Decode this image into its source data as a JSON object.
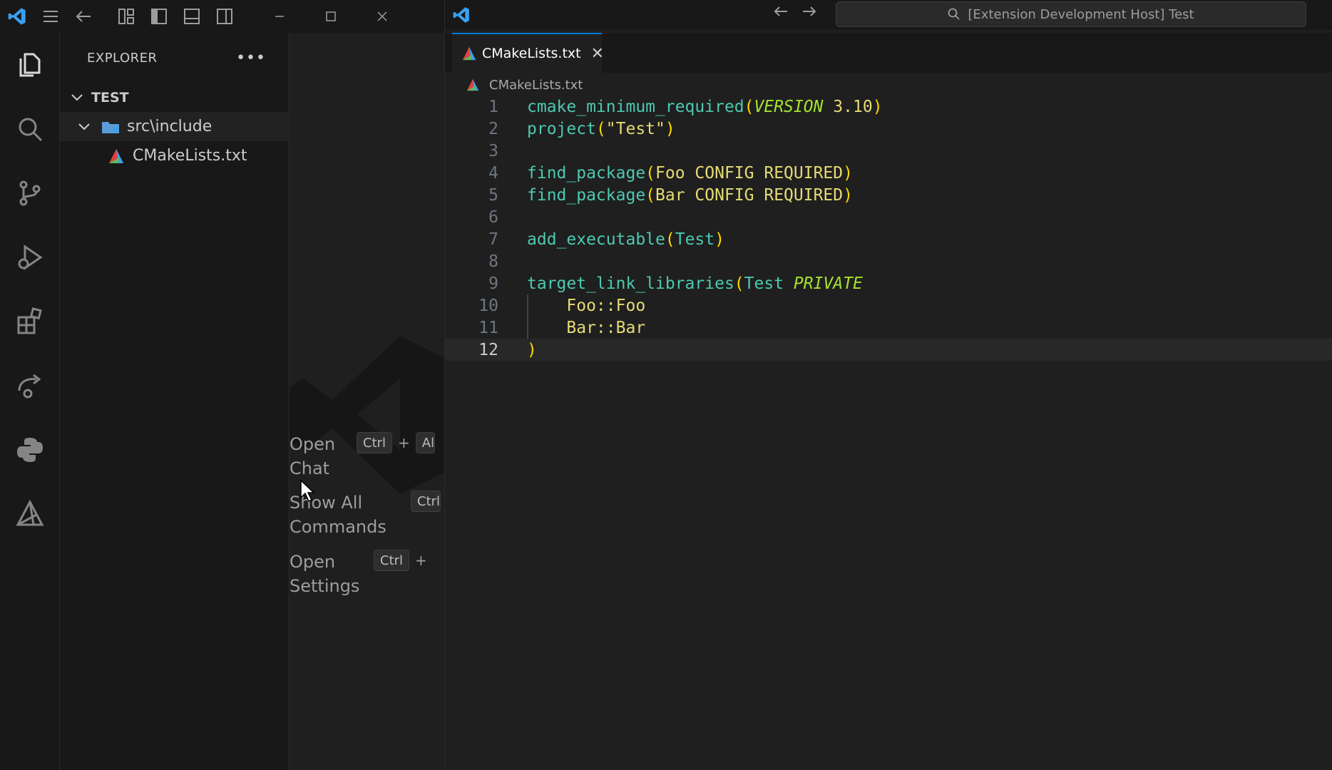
{
  "left_window": {
    "explorer": {
      "header": "EXPLORER",
      "more": "•••",
      "root_folder": "TEST",
      "items": [
        {
          "label": "src\\include",
          "type": "folder"
        },
        {
          "label": "CMakeLists.txt",
          "type": "file"
        }
      ]
    },
    "welcome": {
      "commands": [
        {
          "label_line1": "Open",
          "label_line2": "Chat",
          "keys": [
            "Ctrl",
            "Al"
          ]
        },
        {
          "label_line1": "Show All",
          "label_line2": "Commands",
          "keys": [
            "Ctrl"
          ]
        },
        {
          "label_line1": "Open",
          "label_line2": "Settings",
          "keys": [
            "Ctrl"
          ]
        }
      ],
      "plus": "+"
    }
  },
  "right_window": {
    "search_text": "[Extension Development Host] Test",
    "tab_label": "CMakeLists.txt",
    "breadcrumb": "CMakeLists.txt",
    "code_lines": [
      {
        "n": "1",
        "parts": [
          [
            "fn",
            "cmake_minimum_required"
          ],
          [
            "paren",
            "("
          ],
          [
            "ital",
            "VERSION"
          ],
          [
            "plain",
            " 3.10"
          ],
          [
            "paren",
            ")"
          ]
        ]
      },
      {
        "n": "2",
        "parts": [
          [
            "fn",
            "project"
          ],
          [
            "paren",
            "("
          ],
          [
            "str",
            "\"Test\""
          ],
          [
            "paren",
            ")"
          ]
        ]
      },
      {
        "n": "3",
        "parts": []
      },
      {
        "n": "4",
        "parts": [
          [
            "fn",
            "find_package"
          ],
          [
            "paren",
            "("
          ],
          [
            "plain",
            "Foo CONFIG REQUIRED"
          ],
          [
            "paren",
            ")"
          ]
        ]
      },
      {
        "n": "5",
        "parts": [
          [
            "fn",
            "find_package"
          ],
          [
            "paren",
            "("
          ],
          [
            "plain",
            "Bar CONFIG REQUIRED"
          ],
          [
            "paren",
            ")"
          ]
        ]
      },
      {
        "n": "6",
        "parts": []
      },
      {
        "n": "7",
        "parts": [
          [
            "fn",
            "add_executable"
          ],
          [
            "paren",
            "("
          ],
          [
            "fn",
            "Test"
          ],
          [
            "paren",
            ")"
          ]
        ]
      },
      {
        "n": "8",
        "parts": []
      },
      {
        "n": "9",
        "parts": [
          [
            "fn",
            "target_link_libraries"
          ],
          [
            "paren",
            "("
          ],
          [
            "fn",
            "Test "
          ],
          [
            "ital",
            "PRIVATE"
          ]
        ]
      },
      {
        "n": "10",
        "parts": [
          [
            "plain",
            "    Foo::Foo"
          ]
        ]
      },
      {
        "n": "11",
        "parts": [
          [
            "plain",
            "    Bar::Bar"
          ]
        ]
      },
      {
        "n": "12",
        "parts": [
          [
            "paren",
            ")"
          ]
        ]
      }
    ],
    "current_line": "12"
  },
  "colors": {
    "accent": "#0078d4",
    "function": "#4ec9b0",
    "bracket": "#ffd700",
    "keyword_italic": "#a6e22e",
    "argument": "#e6db74"
  }
}
